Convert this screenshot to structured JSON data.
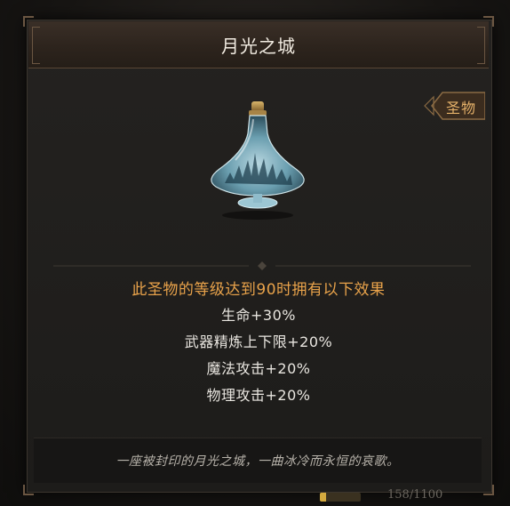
{
  "title": "月光之城",
  "tag": "圣物",
  "item": {
    "icon": "moonlight-city-bottle-icon"
  },
  "effect_heading": "此圣物的等级达到90时拥有以下效果",
  "effects": [
    "生命+30%",
    "武器精炼上下限+20%",
    "魔法攻击+20%",
    "物理攻击+20%"
  ],
  "lore": "一座被封印的月光之城，一曲冰冷而永恒的哀歌。",
  "progress": {
    "text": "158/1100",
    "current": 158,
    "max": 1100
  },
  "colors": {
    "heading": "#e8a24a",
    "tag": "#e6b26a",
    "text": "#e9e6e0",
    "lore": "#b7b2aa"
  }
}
